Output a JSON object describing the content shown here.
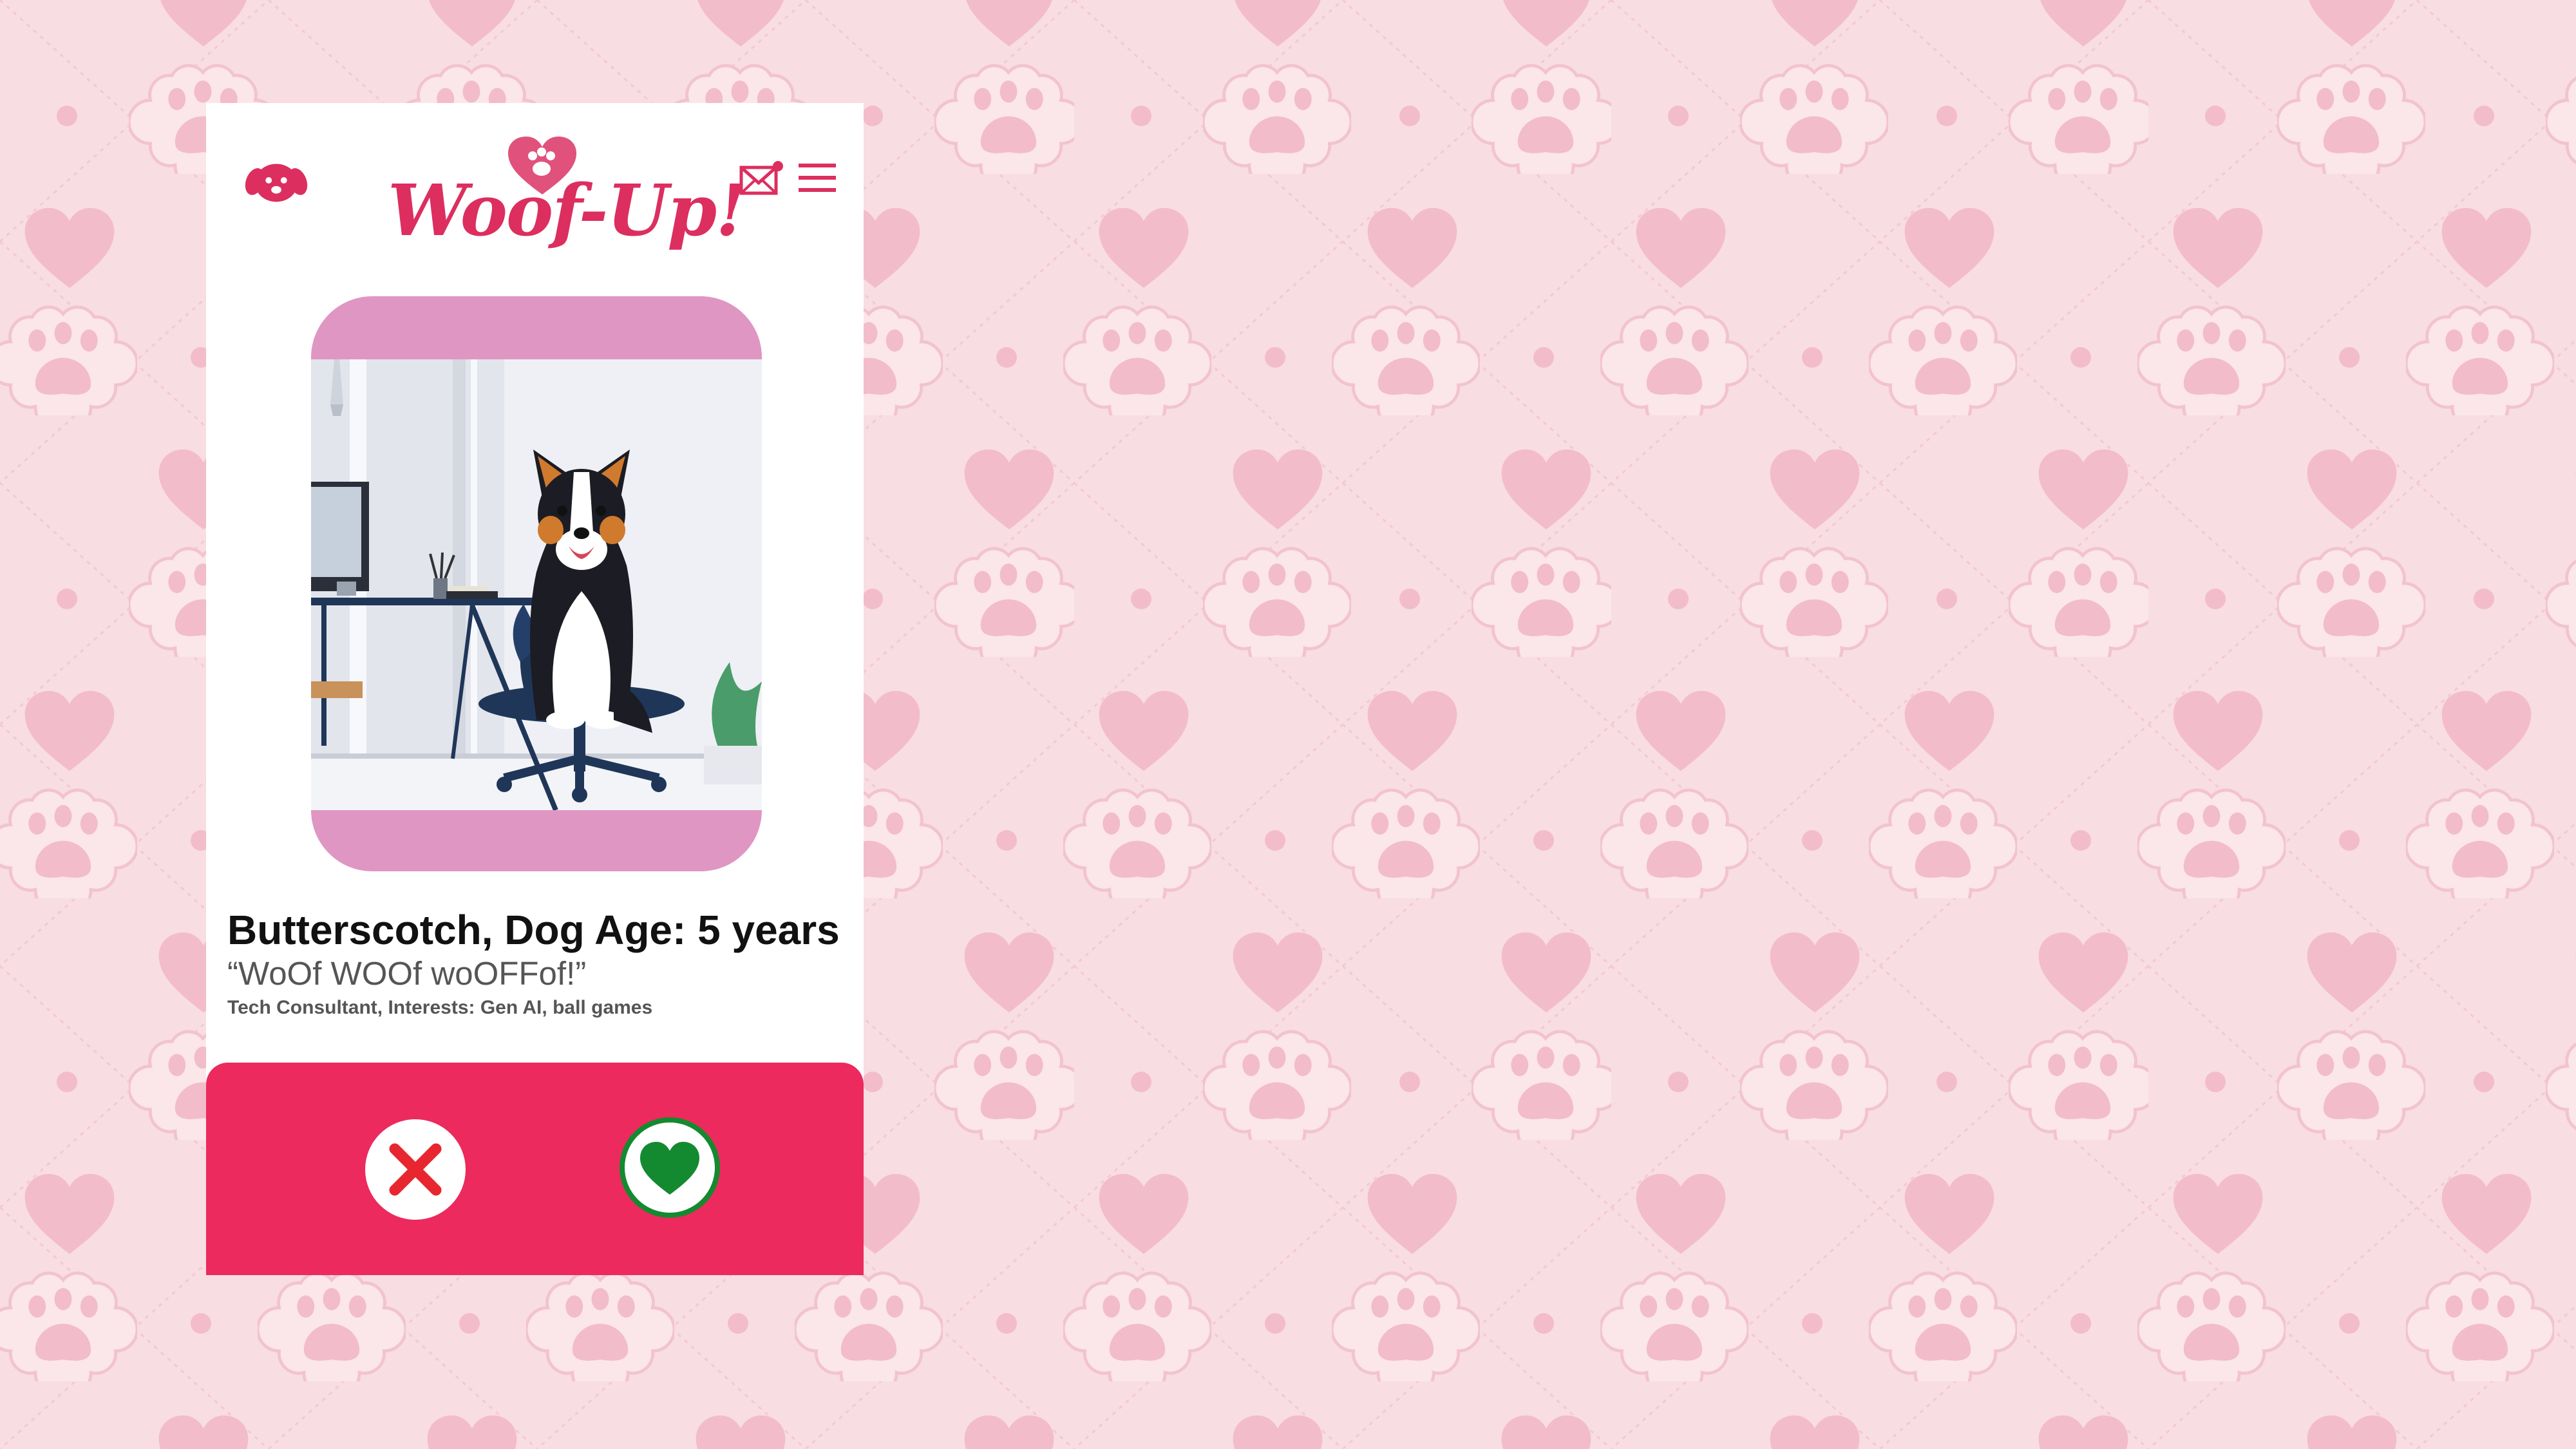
{
  "app": {
    "logo_text": "Woof-Up!"
  },
  "profile": {
    "name_line": "Butterscotch, Dog Age: 5 years",
    "quote": "“WoOf WOOf woOFFof!”",
    "bio": "Tech Consultant, Interests: Gen AI, ball games"
  },
  "icons": {
    "header_left": "dog-face-icon",
    "logo_badge": "paw-heart-icon",
    "messages": "mail-icon",
    "menu": "hamburger-menu-icon",
    "reject": "close-x-icon",
    "like": "heart-icon"
  },
  "colors": {
    "background": "#f8dde3",
    "pattern_heart": "#f3bccb",
    "brand": "#dc2e5f",
    "action_bar": "#ec2a5d",
    "photo_frame": "#e096c3",
    "reject": "#e8262f",
    "like": "#138a2f"
  }
}
